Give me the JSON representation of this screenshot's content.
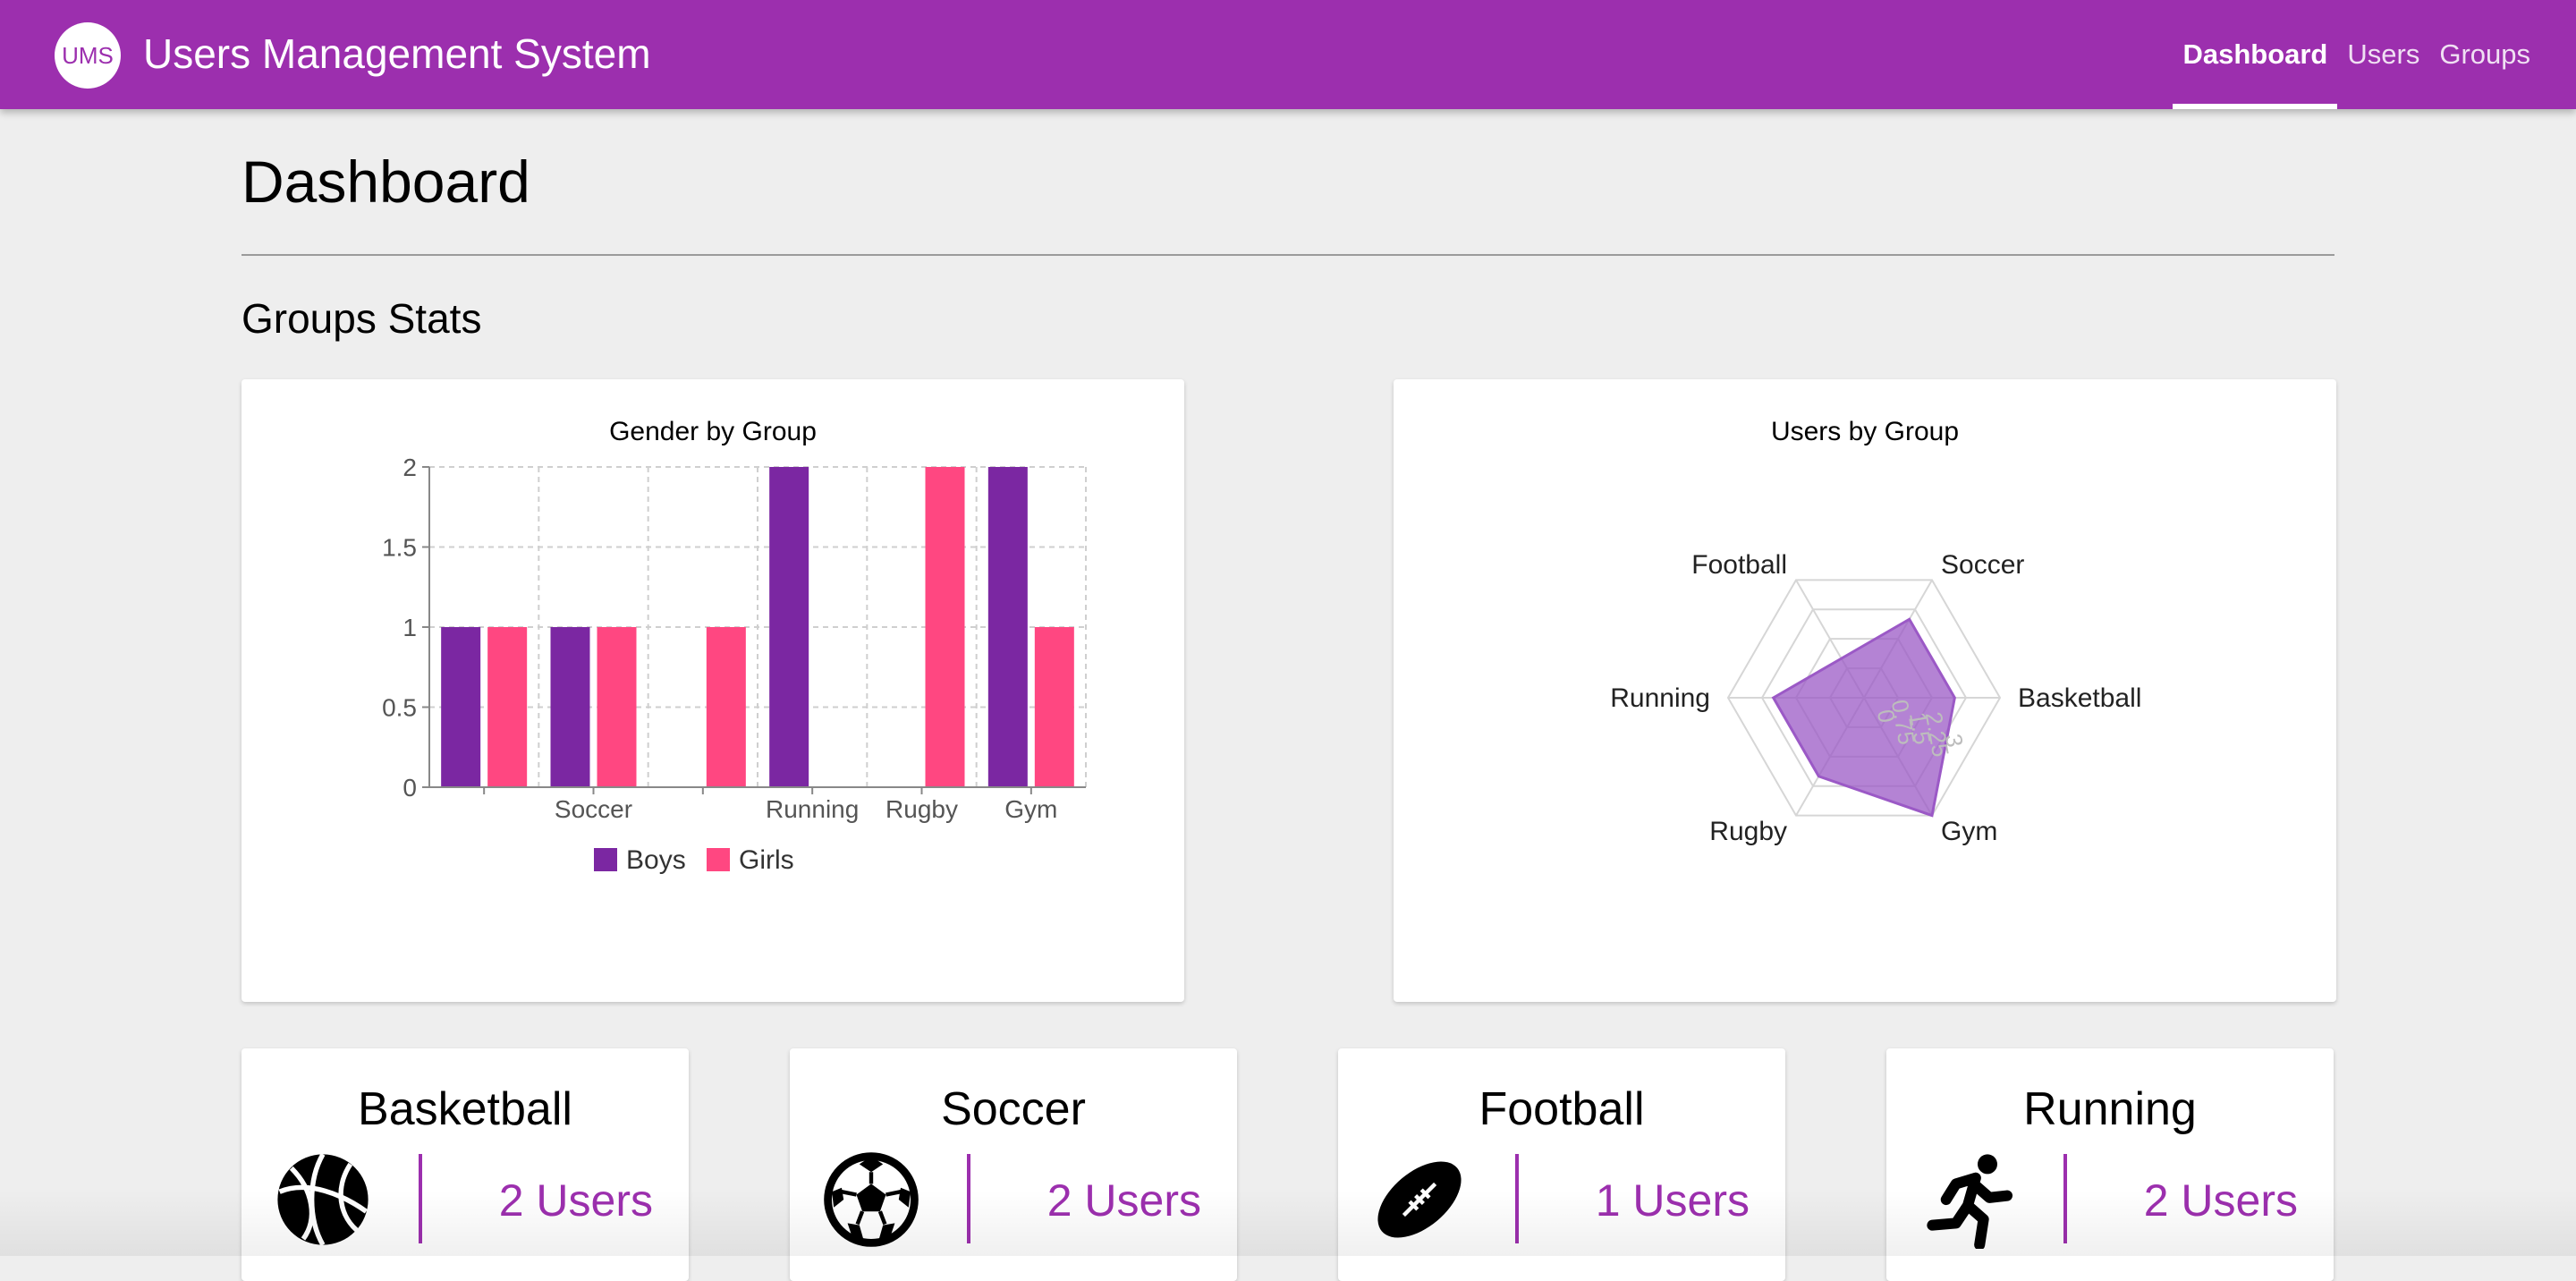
{
  "app": {
    "logo_text": "UMS",
    "title": "Users Management System"
  },
  "nav": {
    "dashboard": "Dashboard",
    "users": "Users",
    "groups": "Groups"
  },
  "page": {
    "title": "Dashboard",
    "section_title": "Groups Stats"
  },
  "colors": {
    "accent": "#9c2fae",
    "boys": "#7b27a2",
    "girls": "#ff4781",
    "radar_fill": "#9b59c6"
  },
  "chart_data": [
    {
      "type": "bar",
      "title": "Gender by Group",
      "categories": [
        "Basketball",
        "Soccer",
        "Football",
        "Running",
        "Rugby",
        "Gym"
      ],
      "category_labels_shown": [
        "",
        "Soccer",
        "",
        "Running",
        "Rugby",
        "Gym"
      ],
      "series": [
        {
          "name": "Boys",
          "values": [
            1,
            1,
            0,
            2,
            0,
            2
          ]
        },
        {
          "name": "Girls",
          "values": [
            1,
            1,
            1,
            0,
            2,
            1
          ]
        }
      ],
      "yticks": [
        "0",
        "0.5",
        "1",
        "1.5",
        "2"
      ],
      "ylim": [
        0,
        2
      ],
      "grid": true,
      "legend": "bottom"
    },
    {
      "type": "radar",
      "title": "Users by Group",
      "categories": [
        "Soccer",
        "Basketball",
        "Gym",
        "Rugby",
        "Running",
        "Football"
      ],
      "values": [
        2,
        2,
        3,
        2,
        2,
        1
      ],
      "ticks": [
        "0",
        "0.75",
        "1.5",
        "2.25",
        "3"
      ],
      "rlim": [
        0,
        3
      ],
      "grid": true
    }
  ],
  "groups": [
    {
      "name": "Basketball",
      "count": "2 Users",
      "icon": "basketball-icon"
    },
    {
      "name": "Soccer",
      "count": "2 Users",
      "icon": "soccer-ball-icon"
    },
    {
      "name": "Football",
      "count": "1 Users",
      "icon": "football-icon"
    },
    {
      "name": "Running",
      "count": "2 Users",
      "icon": "running-icon"
    }
  ]
}
